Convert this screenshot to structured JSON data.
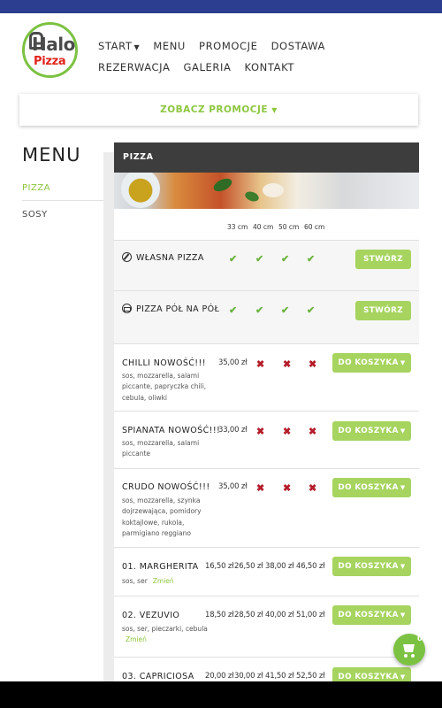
{
  "brand": {
    "logo_word1": "Halo",
    "logo_word2": "Pizza"
  },
  "nav": {
    "items": [
      "START",
      "MENU",
      "PROMOCJE",
      "DOSTAWA",
      "REZERWACJA",
      "GALERIA",
      "KONTAKT"
    ]
  },
  "promo_button": "ZOBACZ PROMOCJE",
  "sidebar": {
    "title": "MENU",
    "items": [
      {
        "label": "PIZZA",
        "active": true
      },
      {
        "label": "SOSY",
        "active": false
      }
    ]
  },
  "section": {
    "title": "PIZZA"
  },
  "sizes": [
    "33 cm",
    "40 cm",
    "50 cm",
    "60 cm"
  ],
  "custom": [
    {
      "name": "WŁASNA PIZZA",
      "button": "STWÓRZ"
    },
    {
      "name": "PIZZA PÓŁ NA PÓŁ",
      "button": "STWÓRZ"
    }
  ],
  "new_items": [
    {
      "name": "CHILLI NOWOŚĆ!!!",
      "desc": "sos, mozzarella, salami piccante, papryczka chili, cebula, oliwki",
      "price": "35,00 zł",
      "button": "DO KOSZYKA"
    },
    {
      "name": "SPIANATA NOWOŚĆ!!!",
      "desc": "sos, mozzarella, salami piccante",
      "price": "33,00 zł",
      "button": "DO KOSZYKA"
    },
    {
      "name": "CRUDO NOWOŚĆ!!!",
      "desc": "sos, mozzarella, szynka dojrzewająca, pomidory koktajlowe, rukola, parmigiano reggiano",
      "price": "35,00 zł",
      "button": "DO KOSZYKA"
    }
  ],
  "items": [
    {
      "name": "01. MARGHERITA",
      "desc": "sos, ser",
      "change": "Zmień",
      "prices": [
        "16,50 zł",
        "26,50 zł",
        "38,00 zł",
        "46,50 zł"
      ],
      "button": "DO KOSZYKA"
    },
    {
      "name": "02. VEZUVIO",
      "desc": "sos, ser, pieczarki, cebula",
      "change": "Zmień",
      "prices": [
        "18,50 zł",
        "28,50 zł",
        "40,00 zł",
        "51,00 zł"
      ],
      "button": "DO KOSZYKA"
    },
    {
      "name": "03. CAPRICIOSA",
      "prices": [
        "20,00 zł",
        "30,00 zł",
        "41,50 zł",
        "52,50 zł"
      ],
      "button": "DO KOSZYKA"
    }
  ],
  "cart": {
    "count": "0"
  },
  "colors": {
    "accent": "#8dc63f",
    "button": "#a6d45f",
    "header": "#3d3d3d",
    "topbar": "#2c3e8f",
    "cross": "#b51d2a"
  }
}
